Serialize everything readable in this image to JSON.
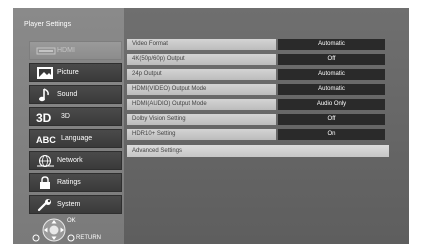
{
  "title": "Player Settings",
  "menu": [
    {
      "label": "HDMI",
      "icon": "hdmi-icon",
      "dim": true
    },
    {
      "label": "Picture",
      "icon": "picture-icon"
    },
    {
      "label": "Sound",
      "icon": "music-note-icon"
    },
    {
      "label": "3D",
      "icon_text": "3D",
      "icon": "3d-icon"
    },
    {
      "label": "Language",
      "icon_text": "ABC",
      "icon": "abc-icon"
    },
    {
      "label": "Network",
      "icon": "network-globe-icon"
    },
    {
      "label": "Ratings",
      "icon": "lock-icon"
    },
    {
      "label": "System",
      "icon": "wrench-icon"
    }
  ],
  "settings": [
    {
      "label": "Video Format",
      "value": "Automatic"
    },
    {
      "label": "4K(50p/60p) Output",
      "value": "Off"
    },
    {
      "label": "24p Output",
      "value": "Automatic"
    },
    {
      "label": "HDMI(VIDEO) Output Mode",
      "value": "Automatic"
    },
    {
      "label": "HDMI(AUDIO) Output Mode",
      "value": "Audio Only"
    },
    {
      "label": "Dolby Vision Setting",
      "value": "Off"
    },
    {
      "label": "HDR10+ Setting",
      "value": "On"
    }
  ],
  "advanced": "Advanced Settings",
  "nav": {
    "ok": "OK",
    "return": "RETURN"
  },
  "colors": {
    "screen_bg": "#666666",
    "sidebar_bg": "#808080",
    "value_bg": "#2a2a2a",
    "label_bg": "#c8c8c8"
  }
}
